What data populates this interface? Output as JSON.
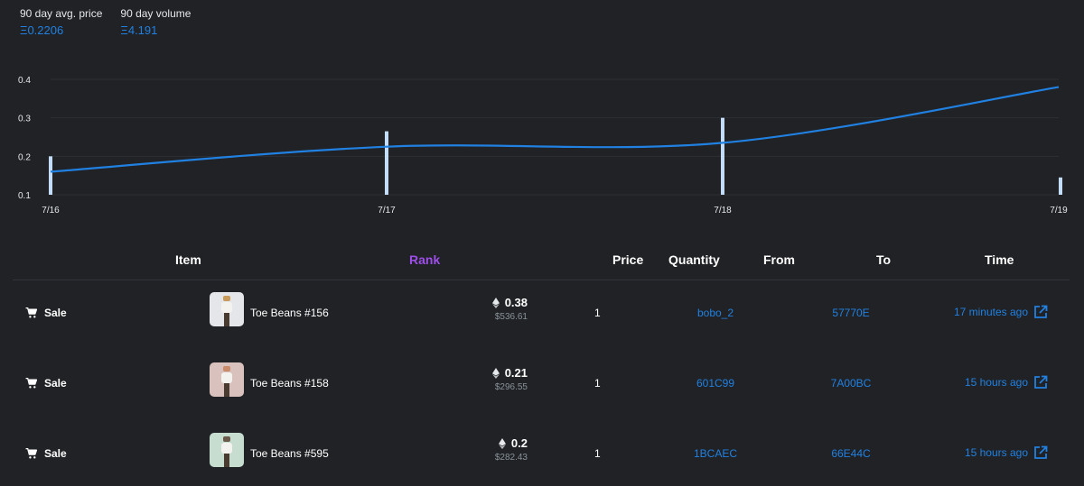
{
  "stats": {
    "avg_label": "90 day avg. price",
    "avg_value": "Ξ0.2206",
    "volume_label": "90 day volume",
    "volume_value": "Ξ4.191"
  },
  "chart_data": {
    "type": "line",
    "x": [
      "7/16",
      "7/17",
      "7/18",
      "7/19"
    ],
    "series": [
      {
        "values": [
          0.16,
          0.225,
          0.235,
          0.38
        ],
        "color": "#2081e2"
      }
    ],
    "volume_bars": [
      0.2,
      0.265,
      0.3,
      0.145
    ],
    "yticks": [
      0.1,
      0.2,
      0.3,
      0.4
    ],
    "ylim": [
      0.1,
      0.4
    ],
    "grid": true
  },
  "table": {
    "headers": {
      "item": "Item",
      "rank": "Rank",
      "price": "Price",
      "quantity": "Quantity",
      "from": "From",
      "to": "To",
      "time": "Time"
    },
    "rank_color": "#9d4ee8",
    "rows": [
      {
        "event": "Sale",
        "item": "Toe Beans #156",
        "price_eth": "0.38",
        "price_usd": "$536.61",
        "quantity": "1",
        "from": "bobo_2",
        "to": "57770E",
        "time": "17 minutes ago",
        "thumb_bg": "#e4e6ea",
        "thumb_accent": "#c99b5a"
      },
      {
        "event": "Sale",
        "item": "Toe Beans #158",
        "price_eth": "0.21",
        "price_usd": "$296.55",
        "quantity": "1",
        "from": "601C99",
        "to": "7A00BC",
        "time": "15 hours ago",
        "thumb_bg": "#d9c2bd",
        "thumb_accent": "#c98b6a"
      },
      {
        "event": "Sale",
        "item": "Toe Beans #595",
        "price_eth": "0.2",
        "price_usd": "$282.43",
        "quantity": "1",
        "from": "1BCAEC",
        "to": "66E44C",
        "time": "15 hours ago",
        "thumb_bg": "#c6ddd0",
        "thumb_accent": "#6b5a4a"
      }
    ]
  },
  "icons": {
    "cart": "cart-icon",
    "eth": "eth-icon",
    "external": "external-link-icon"
  }
}
